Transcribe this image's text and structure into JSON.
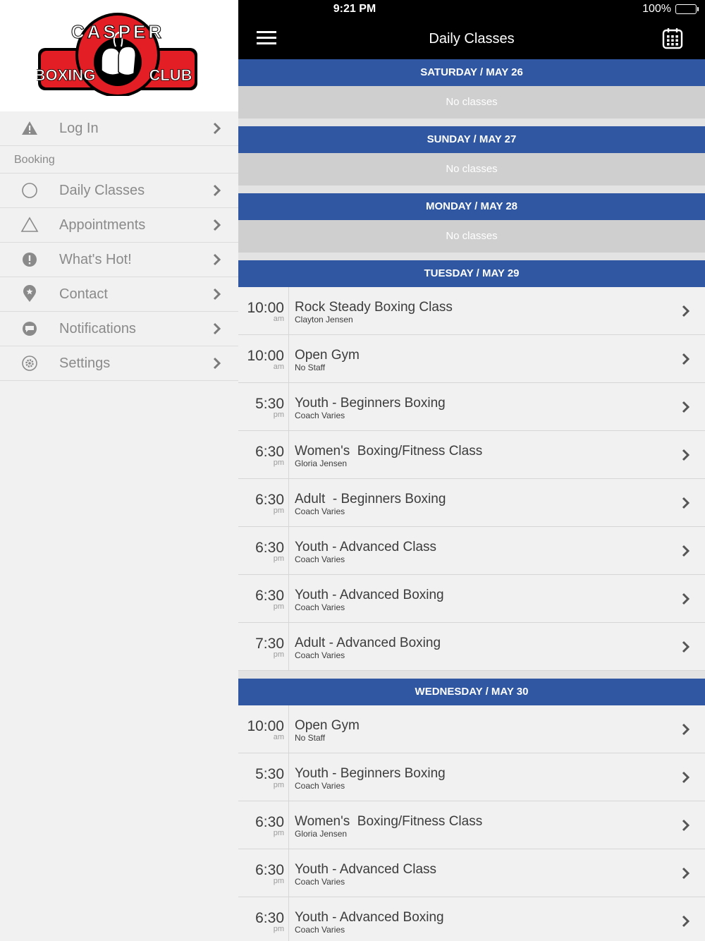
{
  "status": {
    "time": "9:21 PM",
    "battery": "100%",
    "battery_level": 1.0
  },
  "header": {
    "title": "Daily Classes"
  },
  "logo": {
    "top_text": "CASPER",
    "left_text": "BOXING",
    "right_text": "CLUB"
  },
  "sidebar": {
    "login": {
      "label": "Log In",
      "icon": "warning-icon"
    },
    "section": "Booking",
    "items": [
      {
        "label": "Daily Classes",
        "icon": "circle-icon"
      },
      {
        "label": "Appointments",
        "icon": "triangle-icon"
      },
      {
        "label": "What's Hot!",
        "icon": "exclamation-icon"
      },
      {
        "label": "Contact",
        "icon": "location-pin-icon"
      },
      {
        "label": "Notifications",
        "icon": "chat-bubble-icon"
      },
      {
        "label": "Settings",
        "icon": "gear-icon"
      }
    ]
  },
  "days": [
    {
      "label": "SATURDAY / MAY 26",
      "empty_text": "No classes",
      "classes": []
    },
    {
      "label": "SUNDAY / MAY 27",
      "empty_text": "No classes",
      "classes": []
    },
    {
      "label": "MONDAY / MAY 28",
      "empty_text": "No classes",
      "classes": []
    },
    {
      "label": "TUESDAY / MAY 29",
      "classes": [
        {
          "time": "10:00",
          "ampm": "am",
          "name": "Rock Steady Boxing Class",
          "staff": "Clayton Jensen"
        },
        {
          "time": "10:00",
          "ampm": "am",
          "name": "Open Gym",
          "staff": "No Staff"
        },
        {
          "time": "5:30",
          "ampm": "pm",
          "name": "Youth - Beginners Boxing",
          "staff": "Coach Varies"
        },
        {
          "time": "6:30",
          "ampm": "pm",
          "name": "Women's  Boxing/Fitness Class",
          "staff": "Gloria Jensen"
        },
        {
          "time": "6:30",
          "ampm": "pm",
          "name": "Adult  - Beginners Boxing",
          "staff": "Coach Varies"
        },
        {
          "time": "6:30",
          "ampm": "pm",
          "name": "Youth - Advanced Class",
          "staff": "Coach Varies"
        },
        {
          "time": "6:30",
          "ampm": "pm",
          "name": "Youth - Advanced Boxing",
          "staff": "Coach Varies"
        },
        {
          "time": "7:30",
          "ampm": "pm",
          "name": "Adult - Advanced Boxing",
          "staff": "Coach Varies"
        }
      ]
    },
    {
      "label": "WEDNESDAY / MAY 30",
      "classes": [
        {
          "time": "10:00",
          "ampm": "am",
          "name": "Open Gym",
          "staff": "No Staff"
        },
        {
          "time": "5:30",
          "ampm": "pm",
          "name": "Youth - Beginners Boxing",
          "staff": "Coach Varies"
        },
        {
          "time": "6:30",
          "ampm": "pm",
          "name": "Women's  Boxing/Fitness Class",
          "staff": "Gloria Jensen"
        },
        {
          "time": "6:30",
          "ampm": "pm",
          "name": "Youth - Advanced Class",
          "staff": "Coach Varies"
        },
        {
          "time": "6:30",
          "ampm": "pm",
          "name": "Youth - Advanced Boxing",
          "staff": "Coach Varies"
        }
      ]
    }
  ],
  "colors": {
    "day_header": "#2f57a2",
    "logo_red": "#e31e24",
    "topbar": "#000000"
  }
}
